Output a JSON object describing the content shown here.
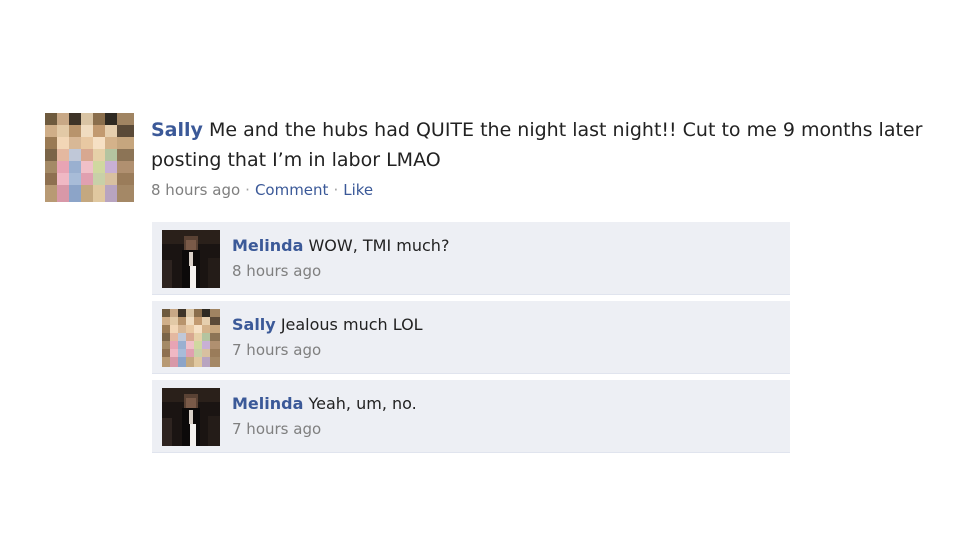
{
  "post": {
    "author": "Sally",
    "text": "Me and the hubs had QUITE the night last night!! Cut to me 9 months later posting that I’m in labor LMAO",
    "time": "8 hours ago",
    "separator": "·",
    "comment_label": "Comment",
    "like_label": "Like"
  },
  "comments": [
    {
      "author": "Melinda",
      "text": "WOW, TMI much?",
      "time": "8 hours ago",
      "avatar": "melinda"
    },
    {
      "author": "Sally",
      "text": "Jealous much LOL",
      "time": "7 hours ago",
      "avatar": "sally"
    },
    {
      "author": "Melinda",
      "text": "Yeah, um, no.",
      "time": "7 hours ago",
      "avatar": "melinda"
    }
  ],
  "colors": {
    "link": "#3b5998",
    "comment_bg": "#edeff4",
    "meta_text": "#7f7f7f"
  }
}
